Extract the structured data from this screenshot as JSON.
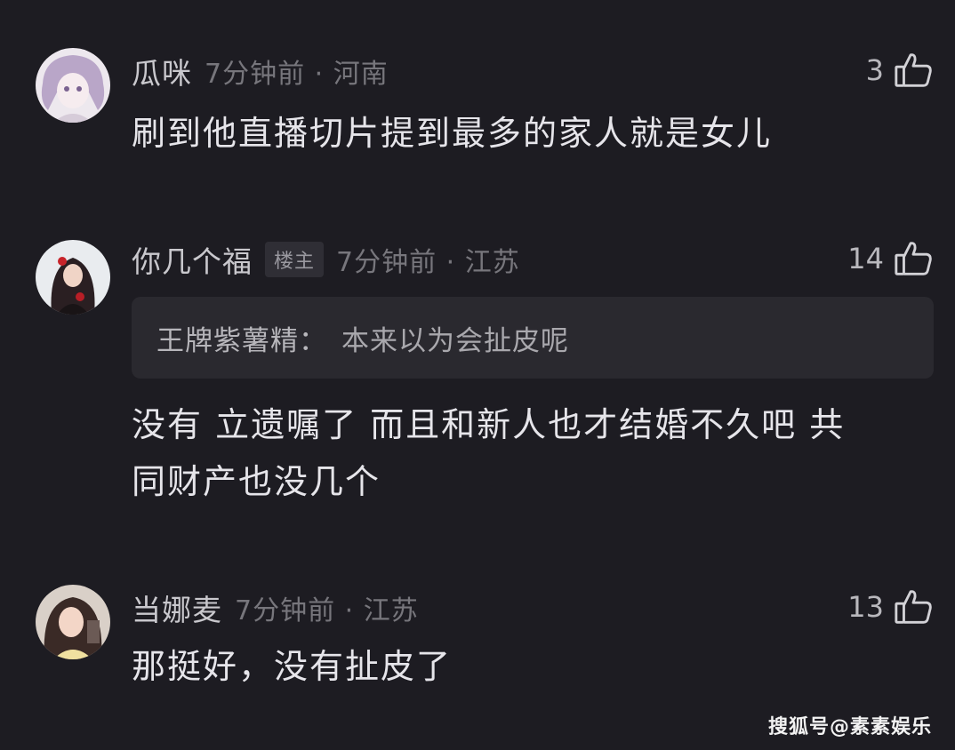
{
  "comments": [
    {
      "username": "瓜咪",
      "time_location": "7分钟前 · 河南",
      "likes": "3",
      "text": "刷到他直播切片提到最多的家人就是女儿"
    },
    {
      "username": "你几个福",
      "badge": "楼主",
      "time_location": "7分钟前 · 江苏",
      "likes": "14",
      "reply": {
        "user": "王牌紫薯精：",
        "text": "本来以为会扯皮呢"
      },
      "text_line1": "没有 立遗嘱了 而且和新人也才结婚不久吧 共",
      "text_line2": "同财产也没几个"
    },
    {
      "username": "当娜麦",
      "time_location": "7分钟前 · 江苏",
      "likes": "13",
      "text": "那挺好，没有扯皮了"
    }
  ],
  "watermark": "搜狐号@素素娱乐",
  "colors": {
    "background": "#1d1c22",
    "username": "#c9c8cd",
    "body_text": "#e6e5ea",
    "meta_text": "#77767c",
    "reply_box": "#2a292f"
  },
  "icons": {
    "like": "thumbs-up-icon"
  }
}
